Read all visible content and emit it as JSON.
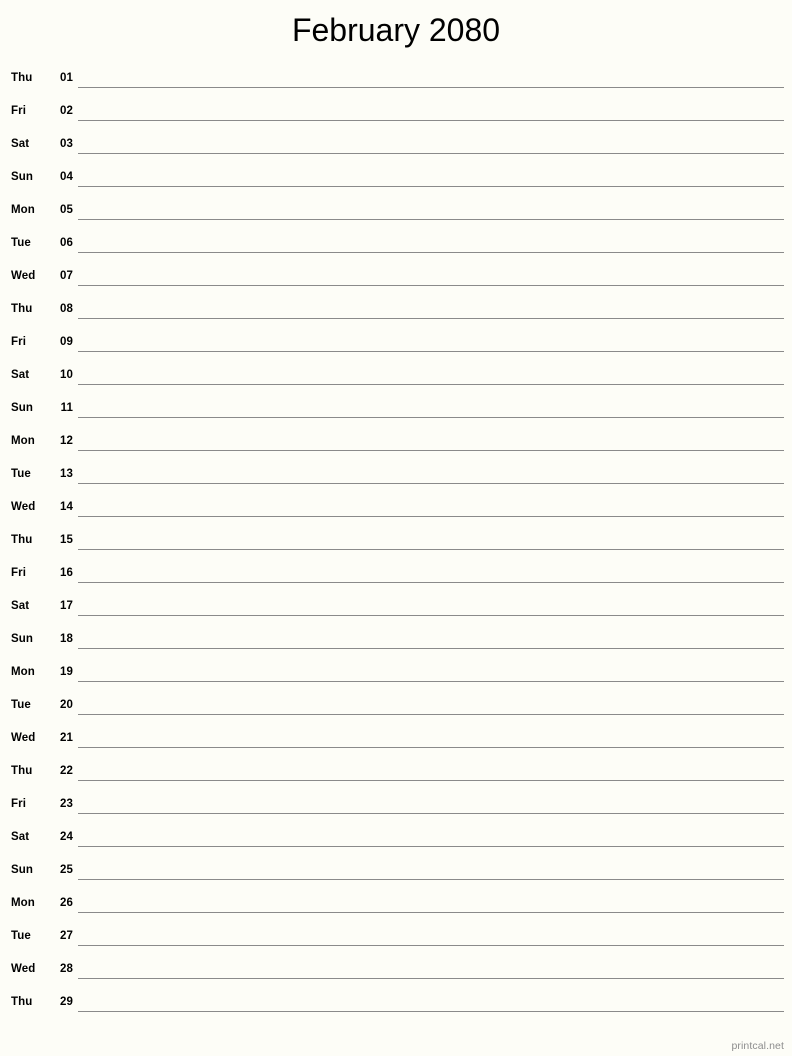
{
  "document": {
    "title": "February 2080",
    "month": "February",
    "year": "2080",
    "type": "monthly-notes-calendar",
    "page_size": "792x1056"
  },
  "colors": {
    "background": "#fdfdf7",
    "text": "#000000",
    "rule_line": "#8a8a8a",
    "footer_text": "#8d8d8d"
  },
  "footer": {
    "attribution": "printcal.net"
  },
  "days": [
    {
      "weekday": "Thu",
      "date": "01"
    },
    {
      "weekday": "Fri",
      "date": "02"
    },
    {
      "weekday": "Sat",
      "date": "03"
    },
    {
      "weekday": "Sun",
      "date": "04"
    },
    {
      "weekday": "Mon",
      "date": "05"
    },
    {
      "weekday": "Tue",
      "date": "06"
    },
    {
      "weekday": "Wed",
      "date": "07"
    },
    {
      "weekday": "Thu",
      "date": "08"
    },
    {
      "weekday": "Fri",
      "date": "09"
    },
    {
      "weekday": "Sat",
      "date": "10"
    },
    {
      "weekday": "Sun",
      "date": "11"
    },
    {
      "weekday": "Mon",
      "date": "12"
    },
    {
      "weekday": "Tue",
      "date": "13"
    },
    {
      "weekday": "Wed",
      "date": "14"
    },
    {
      "weekday": "Thu",
      "date": "15"
    },
    {
      "weekday": "Fri",
      "date": "16"
    },
    {
      "weekday": "Sat",
      "date": "17"
    },
    {
      "weekday": "Sun",
      "date": "18"
    },
    {
      "weekday": "Mon",
      "date": "19"
    },
    {
      "weekday": "Tue",
      "date": "20"
    },
    {
      "weekday": "Wed",
      "date": "21"
    },
    {
      "weekday": "Thu",
      "date": "22"
    },
    {
      "weekday": "Fri",
      "date": "23"
    },
    {
      "weekday": "Sat",
      "date": "24"
    },
    {
      "weekday": "Sun",
      "date": "25"
    },
    {
      "weekday": "Mon",
      "date": "26"
    },
    {
      "weekday": "Tue",
      "date": "27"
    },
    {
      "weekday": "Wed",
      "date": "28"
    },
    {
      "weekday": "Thu",
      "date": "29"
    }
  ]
}
